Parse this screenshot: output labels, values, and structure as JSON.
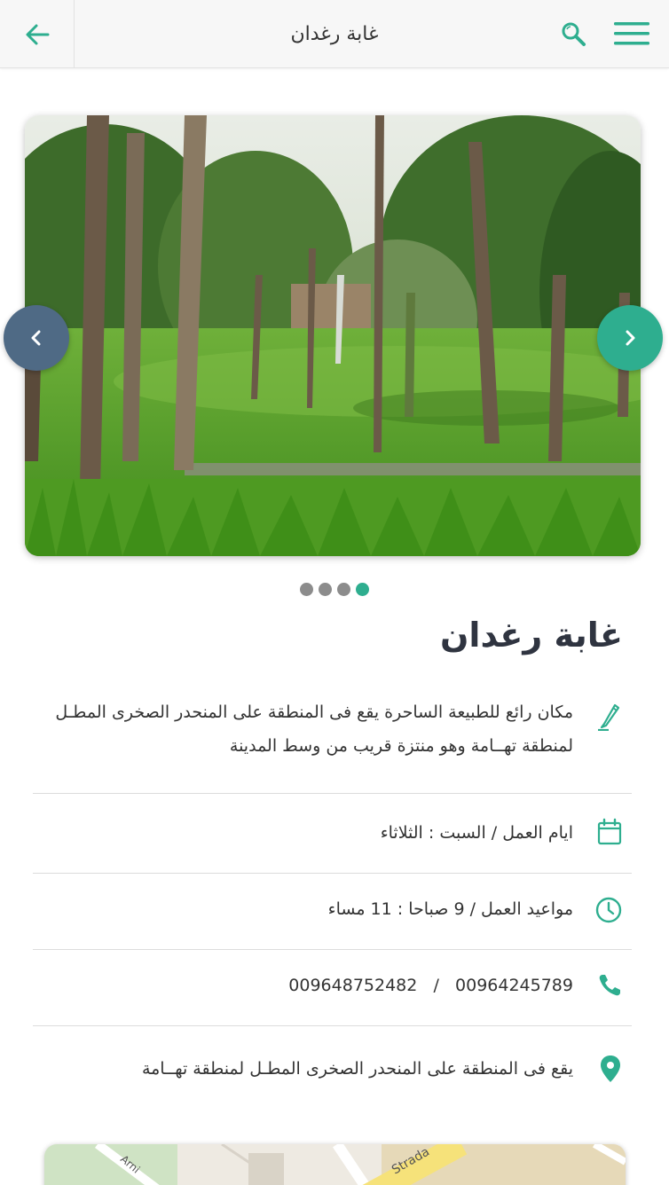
{
  "header": {
    "title": "غابة رغدان"
  },
  "slider": {
    "total_slides": 4,
    "active_slide": 4
  },
  "place": {
    "name": "غابة رغدان",
    "description": "مكان رائع للطبيعة الساحرة يقع فى المنطقة على المنحدر الصخرى المطـل لمنطقة تهــامة وهو منتزة قريب من وسط المدينة",
    "working_days_label": "ايام العمل /",
    "working_days_value": "السبت : الثلاثاء",
    "working_hours_label": "مواعيد العمل /",
    "working_hours_value": "9  صباحا : 11 مساء",
    "phone_1": "00964245789",
    "phone_separator": "/",
    "phone_2": "009648752482",
    "address": "يقع فى المنطقة على المنحدر الصخرى المطـل لمنطقة تهــامة"
  },
  "map": {
    "labels": [
      "Strada",
      "Arni"
    ]
  },
  "colors": {
    "accent": "#2eae8f",
    "prev_button": "#4f6a85",
    "dot_inactive": "#8c8c8c",
    "header_bg": "#f7f7f7"
  },
  "icons": {
    "back": "arrow-left-icon",
    "search": "search-icon",
    "menu": "hamburger-menu-icon",
    "description": "pencil-icon",
    "days": "calendar-icon",
    "hours": "clock-icon",
    "phone": "phone-icon",
    "location": "map-pin-icon"
  }
}
